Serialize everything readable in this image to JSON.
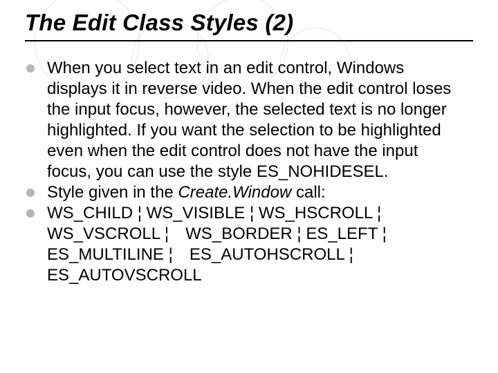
{
  "slide": {
    "title": "The Edit Class Styles (2)",
    "bullets": [
      {
        "text": "When you select text in an edit control, Windows displays it in reverse video. When the edit control loses the input focus, however, the selected text is no longer highlighted. If you want the selection to be highlighted even when the edit control does not have the input focus, you can use the style ES_NOHIDESEL."
      },
      {
        "prefix": "Style given in the ",
        "italic": "Create.Window",
        "suffix": " call:"
      },
      {
        "text": "WS_CHILD ¦ WS_VISIBLE ¦ WS_HSCROLL ¦ WS_VSCROLL ¦ WS_BORDER ¦ ES_LEFT ¦ ES_MULTILINE ¦ ES_AUTOHSCROLL ¦ ES_AUTOVSCROLL"
      }
    ]
  }
}
